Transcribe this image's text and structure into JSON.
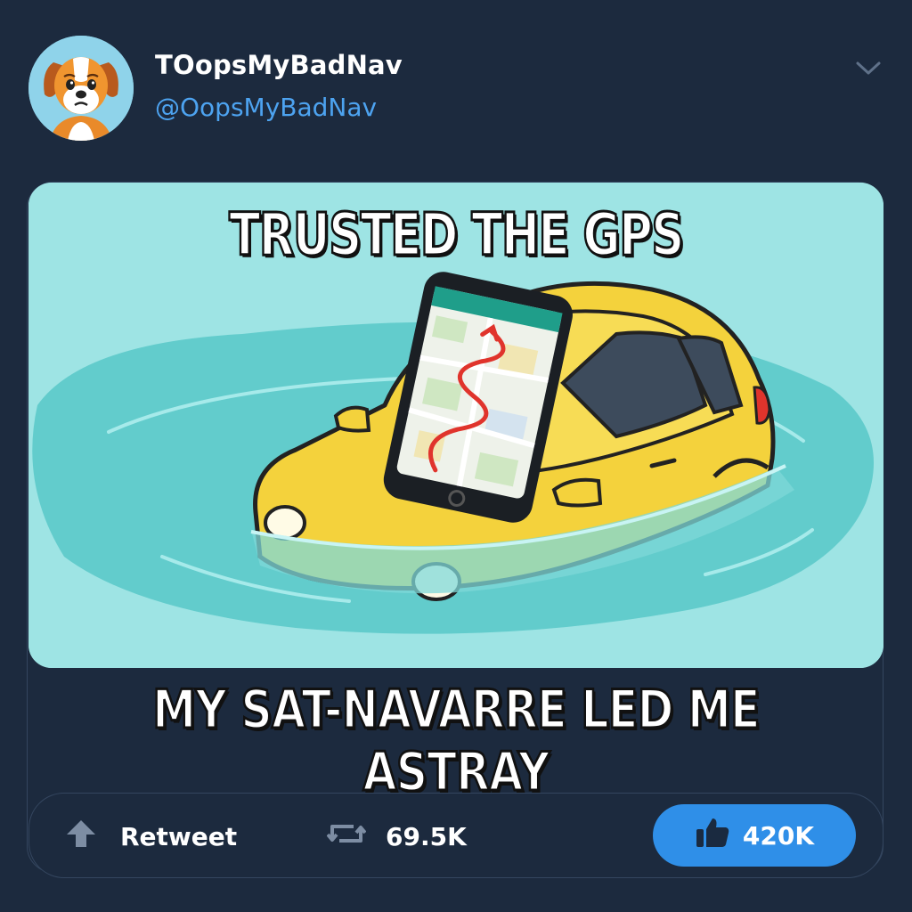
{
  "tweet": {
    "display_name": "TOopsMyBadNav",
    "handle": "@OopsMyBadNav",
    "avatar_icon": "dog-avatar-icon",
    "menu_icon": "chevron-down-icon"
  },
  "meme": {
    "top_text": "TRUSTED THE GPS",
    "bottom_text": "MY SAT-NAVARRE LED ME ASTRAY",
    "image_description_icons": [
      "yellow-car-icon",
      "smartphone-map-icon",
      "water-icon"
    ]
  },
  "actions": {
    "retweet_label": "Retweet",
    "retweet_count": "69.5K",
    "like_count": "420K"
  },
  "colors": {
    "background": "#1c2a3e",
    "handle": "#4da3f0",
    "like_button": "#2f8fe8",
    "water": "#7fd8d8",
    "car": "#f4d23c"
  }
}
